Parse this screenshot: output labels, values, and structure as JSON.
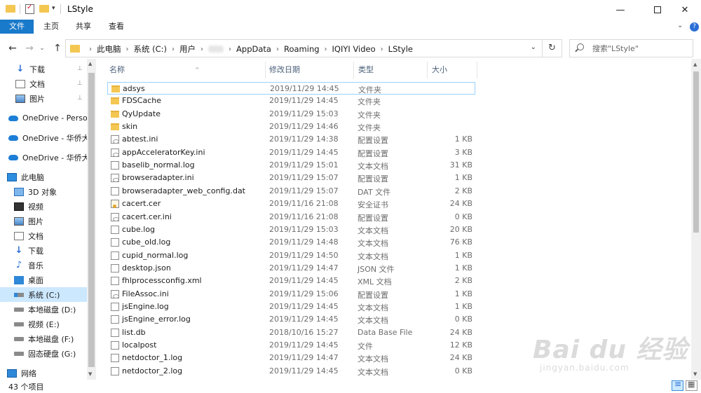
{
  "window": {
    "title": "LStyle",
    "min_glyph": "—",
    "close_glyph": "✕"
  },
  "ribbon": {
    "tabs": [
      "文件",
      "主页",
      "共享",
      "查看"
    ],
    "expand_glyph": "⌄",
    "help_glyph": "?"
  },
  "nav": {
    "back": "←",
    "forward": "→",
    "recent": "⌄",
    "up": "↑",
    "breadcrumb": [
      "此电脑",
      "系统 (C:)",
      "用户",
      "",
      "AppData",
      "Roaming",
      "IQIYI Video",
      "LStyle"
    ],
    "separator": "›",
    "dropdown": "⌄",
    "refresh": "↻"
  },
  "search": {
    "placeholder": "搜索\"LStyle\""
  },
  "sidebar": {
    "items": [
      {
        "label": "下载",
        "icon": "download-icon",
        "pinned": true
      },
      {
        "label": "文档",
        "icon": "document-icon",
        "pinned": true
      },
      {
        "label": "图片",
        "icon": "picture-icon",
        "pinned": true
      },
      {
        "label": "OneDrive - Personal",
        "icon": "onedrive-icon",
        "pinned": false
      },
      {
        "label": "OneDrive - 华侨大学",
        "icon": "onedrive-icon",
        "pinned": false
      },
      {
        "label": "OneDrive - 华侨大学",
        "icon": "onedrive-icon",
        "pinned": false
      },
      {
        "label": "此电脑",
        "icon": "this-pc-icon",
        "pinned": false
      },
      {
        "label": "3D 对象",
        "icon": "3d-objects-icon",
        "pinned": false
      },
      {
        "label": "视频",
        "icon": "video-icon",
        "pinned": false
      },
      {
        "label": "图片",
        "icon": "picture-icon",
        "pinned": false
      },
      {
        "label": "文档",
        "icon": "document-icon",
        "pinned": false
      },
      {
        "label": "下载",
        "icon": "download-icon",
        "pinned": false
      },
      {
        "label": "音乐",
        "icon": "music-icon",
        "pinned": false
      },
      {
        "label": "桌面",
        "icon": "desktop-icon",
        "pinned": false
      },
      {
        "label": "系统 (C:)",
        "icon": "system-drive-icon",
        "pinned": false,
        "selected": true
      },
      {
        "label": "本地磁盘 (D:)",
        "icon": "drive-icon",
        "pinned": false
      },
      {
        "label": "视频 (E:)",
        "icon": "drive-icon",
        "pinned": false
      },
      {
        "label": "本地磁盘 (F:)",
        "icon": "drive-icon",
        "pinned": false
      },
      {
        "label": "固态硬盘 (G:)",
        "icon": "drive-icon",
        "pinned": false
      },
      {
        "label": "网络",
        "icon": "network-icon",
        "pinned": false
      }
    ],
    "pin_glyph": "📌"
  },
  "columns": {
    "name": "名称",
    "date": "修改日期",
    "type": "类型",
    "size": "大小",
    "sort_glyph": "^"
  },
  "files": [
    {
      "name": "adsys",
      "date": "2019/11/29 14:45",
      "type": "文件夹",
      "size": "",
      "kind": "folder"
    },
    {
      "name": "FDSCache",
      "date": "2019/11/29 14:45",
      "type": "文件夹",
      "size": "",
      "kind": "folder"
    },
    {
      "name": "QyUpdate",
      "date": "2019/11/29 15:03",
      "type": "文件夹",
      "size": "",
      "kind": "folder"
    },
    {
      "name": "skin",
      "date": "2019/11/29 14:46",
      "type": "文件夹",
      "size": "",
      "kind": "folder"
    },
    {
      "name": "abtest.ini",
      "date": "2019/11/29 14:38",
      "type": "配置设置",
      "size": "1 KB",
      "kind": "ini"
    },
    {
      "name": "appAcceleratorKey.ini",
      "date": "2019/11/29 14:45",
      "type": "配置设置",
      "size": "3 KB",
      "kind": "ini"
    },
    {
      "name": "baselib_normal.log",
      "date": "2019/11/29 15:01",
      "type": "文本文档",
      "size": "31 KB",
      "kind": "file"
    },
    {
      "name": "browseradapter.ini",
      "date": "2019/11/29 15:07",
      "type": "配置设置",
      "size": "1 KB",
      "kind": "ini"
    },
    {
      "name": "browseradapter_web_config.dat",
      "date": "2019/11/29 15:07",
      "type": "DAT 文件",
      "size": "2 KB",
      "kind": "file"
    },
    {
      "name": "cacert.cer",
      "date": "2019/11/16 21:08",
      "type": "安全证书",
      "size": "24 KB",
      "kind": "cert"
    },
    {
      "name": "cacert.cer.ini",
      "date": "2019/11/16 21:08",
      "type": "配置设置",
      "size": "0 KB",
      "kind": "ini"
    },
    {
      "name": "cube.log",
      "date": "2019/11/29 15:03",
      "type": "文本文档",
      "size": "20 KB",
      "kind": "file"
    },
    {
      "name": "cube_old.log",
      "date": "2019/11/29 14:48",
      "type": "文本文档",
      "size": "76 KB",
      "kind": "file"
    },
    {
      "name": "cupid_normal.log",
      "date": "2019/11/29 14:50",
      "type": "文本文档",
      "size": "1 KB",
      "kind": "file"
    },
    {
      "name": "desktop.json",
      "date": "2019/11/29 14:47",
      "type": "JSON 文件",
      "size": "1 KB",
      "kind": "file"
    },
    {
      "name": "fhlprocessconfig.xml",
      "date": "2019/11/29 14:45",
      "type": "XML 文档",
      "size": "2 KB",
      "kind": "file"
    },
    {
      "name": "FileAssoc.ini",
      "date": "2019/11/29 15:06",
      "type": "配置设置",
      "size": "1 KB",
      "kind": "ini"
    },
    {
      "name": "jsEngine.log",
      "date": "2019/11/29 14:45",
      "type": "文本文档",
      "size": "1 KB",
      "kind": "file"
    },
    {
      "name": "jsEngine_error.log",
      "date": "2019/11/29 14:45",
      "type": "文本文档",
      "size": "0 KB",
      "kind": "file"
    },
    {
      "name": "list.db",
      "date": "2018/10/16 15:27",
      "type": "Data Base File",
      "size": "24 KB",
      "kind": "file"
    },
    {
      "name": "localpost",
      "date": "2019/11/29 14:45",
      "type": "文件",
      "size": "12 KB",
      "kind": "file"
    },
    {
      "name": "netdoctor_1.log",
      "date": "2019/11/29 14:47",
      "type": "文本文档",
      "size": "24 KB",
      "kind": "file"
    },
    {
      "name": "netdoctor_2.log",
      "date": "2019/11/29 14:45",
      "type": "文本文档",
      "size": "0 KB",
      "kind": "file"
    }
  ],
  "status": {
    "item_count": "43 个项目"
  },
  "watermark": {
    "logo": "Bai du 经验",
    "url": "jingyan.baidu.com"
  }
}
